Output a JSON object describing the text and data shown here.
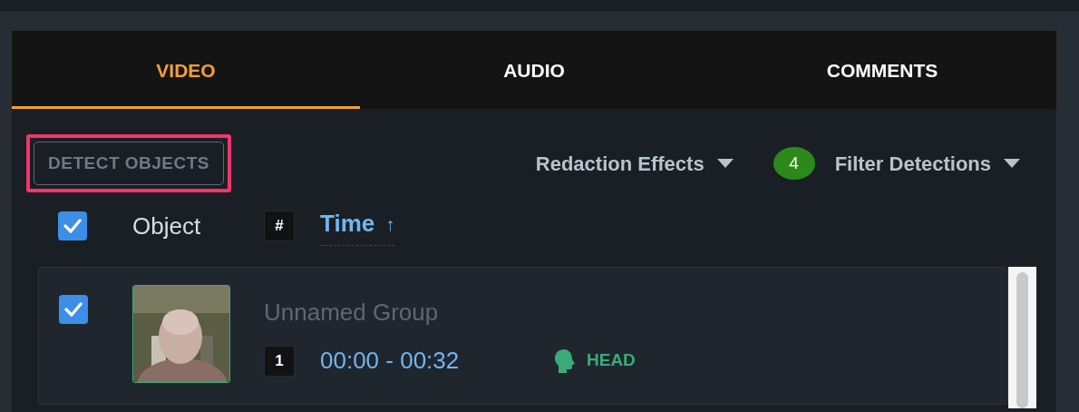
{
  "tabs": [
    {
      "label": "VIDEO",
      "selected": true
    },
    {
      "label": "AUDIO",
      "selected": false
    },
    {
      "label": "COMMENTS",
      "selected": false
    }
  ],
  "toolbar": {
    "detect_button": {
      "label": "DETECT OBJECTS",
      "highlighted": true
    },
    "redaction_menu": {
      "label": "Redaction Effects"
    },
    "filter_menu": {
      "count": "4",
      "label": "Filter Detections"
    }
  },
  "header": {
    "checked": true,
    "object": "Object",
    "number": "#",
    "time": "Time",
    "sort_arrow": "↑"
  },
  "rows": [
    {
      "checked": true,
      "name": "Unnamed Group",
      "index": "1",
      "time_range": "00:00 - 00:32",
      "detection": {
        "kind": "head",
        "label": "HEAD"
      }
    }
  ]
}
